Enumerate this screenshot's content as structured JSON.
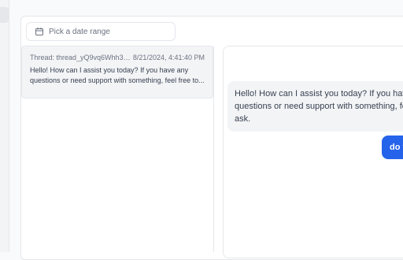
{
  "filter": {
    "date_range_placeholder": "Pick a date range",
    "icon": "calendar-icon"
  },
  "threads": [
    {
      "id_label": "Thread: thread_yQ9vq6Whh39...",
      "timestamp": "8/21/2024, 4:41:40 PM",
      "preview": "Hello! How can I assist you today? If you have any questions or need support with something, feel free to..."
    }
  ],
  "chat": {
    "assistant_message": "Hello! How can I assist you today? If you have a questions or need support with something, feel ask.",
    "user_message": "do y"
  },
  "colors": {
    "accent": "#2563eb",
    "bubble_bg": "#f3f4f6",
    "border": "#e5e7eb"
  }
}
